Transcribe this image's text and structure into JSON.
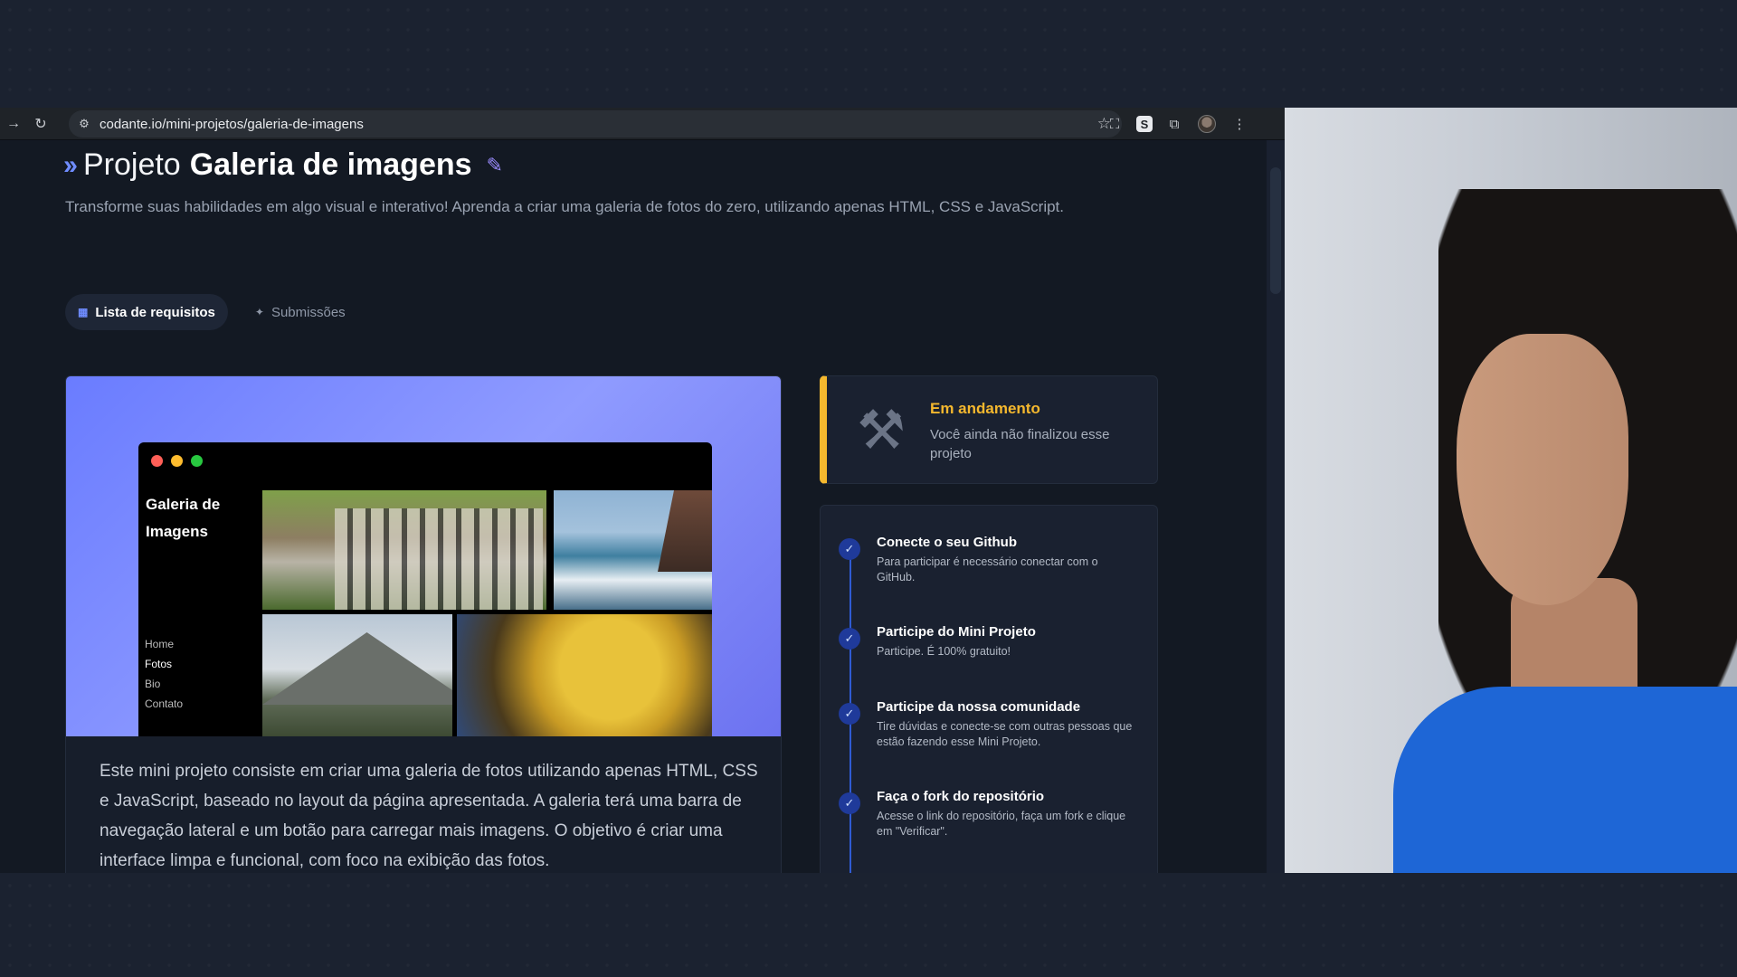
{
  "browser": {
    "url": "codante.io/mini-projetos/galeria-de-imagens",
    "icons": [
      "forward-icon",
      "reload-icon",
      "site-settings-icon",
      "bookmark-star-icon",
      "screenshot-icon",
      "extension-s-icon",
      "extensions-puzzle-icon",
      "profile-avatar",
      "more-menu-icon"
    ]
  },
  "page": {
    "title_prefix": "Projeto",
    "title_bold": "Galeria de imagens",
    "subtitle": "Transforme suas habilidades em algo visual e interativo! Aprenda a criar uma galeria de fotos do zero, utilizando apenas HTML, CSS e JavaScript.",
    "tabs": [
      {
        "label": "Lista de requisitos",
        "active": true
      },
      {
        "label": "Submissões",
        "active": false
      }
    ],
    "mockup": {
      "title": "Galeria de Imagens",
      "nav": [
        "Home",
        "Fotos",
        "Bio",
        "Contato"
      ]
    },
    "description": "Este mini projeto consiste em criar uma galeria de fotos utilizando apenas HTML, CSS e JavaScript, baseado no layout da página apresentada. A galeria terá uma barra de navegação lateral e um botão para carregar mais imagens. O objetivo é criar uma interface limpa e funcional, com foco na exibição das fotos.",
    "status": {
      "title": "Em andamento",
      "text": "Você ainda não finalizou esse projeto",
      "accent": "#f5b82e"
    },
    "steps": [
      {
        "title": "Conecte o seu Github",
        "text": "Para participar é necessário conectar com o GitHub."
      },
      {
        "title": "Participe do Mini Projeto",
        "text": "Participe. É 100% gratuito!"
      },
      {
        "title": "Participe da nossa comunidade",
        "text": "Tire dúvidas e conecte-se com outras pessoas que estão fazendo esse Mini Projeto."
      },
      {
        "title": "Faça o fork do repositório",
        "text": "Acesse o link do repositório, faça um fork e clique em \"Verificar\"."
      }
    ]
  }
}
